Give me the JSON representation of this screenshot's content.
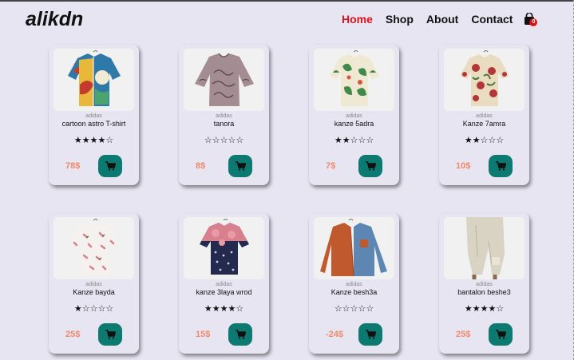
{
  "header": {
    "logo": "alikdn",
    "nav": [
      "Home",
      "Shop",
      "About",
      "Contact"
    ],
    "active_nav": "Home",
    "cart_count": "0"
  },
  "products": [
    {
      "brand": "adidas",
      "name": "cartoon astro T-shirt",
      "rating": 4,
      "price": "78$"
    },
    {
      "brand": "adidas",
      "name": "tanora",
      "rating": 0,
      "price": "8$"
    },
    {
      "brand": "adidas",
      "name": "kanze 5adra",
      "rating": 2,
      "price": "7$"
    },
    {
      "brand": "adidas",
      "name": "Kanze 7amra",
      "rating": 2,
      "price": "10$"
    },
    {
      "brand": "adidas",
      "name": "Kanze bayda",
      "rating": 1,
      "price": "25$"
    },
    {
      "brand": "adidas",
      "name": "kanze 3laya wrod",
      "rating": 4,
      "price": "15$"
    },
    {
      "brand": "adidas",
      "name": "Kanze besh3a",
      "rating": 0,
      "price": "-24$"
    },
    {
      "brand": "adidas",
      "name": "bantalon beshe3",
      "rating": 4,
      "price": "25$"
    }
  ],
  "colors": {
    "background": "#e6e5f1",
    "active_nav": "#e0101a",
    "price": "#f08a6a",
    "buy_button": "#0c7a70"
  },
  "icons": {
    "cart": "shopping-bag-icon",
    "buy": "cart-icon",
    "rating": "star-icon"
  }
}
